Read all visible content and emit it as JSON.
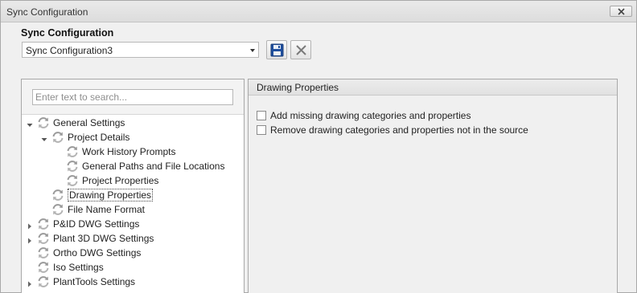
{
  "window": {
    "title": "Sync Configuration"
  },
  "config": {
    "label": "Sync Configuration",
    "selected": "Sync Configuration3"
  },
  "toolbar": {
    "save_icon": "floppy-disk-icon",
    "delete_icon": "x-delete-icon"
  },
  "search": {
    "placeholder": "Enter text to search..."
  },
  "tree": {
    "nodes": [
      {
        "label": "General Settings",
        "expander": "expanded",
        "icon": "sync-icon"
      },
      {
        "label": "Project Details",
        "expander": "expanded",
        "icon": "sync-icon"
      },
      {
        "label": "Work History Prompts",
        "expander": "none",
        "icon": "sync-icon"
      },
      {
        "label": "General Paths and File Locations",
        "expander": "none",
        "icon": "sync-icon"
      },
      {
        "label": "Project Properties",
        "expander": "none",
        "icon": "sync-icon"
      },
      {
        "label": "Drawing Properties",
        "expander": "none",
        "icon": "sync-icon",
        "selected": true
      },
      {
        "label": "File Name Format",
        "expander": "none",
        "icon": "sync-icon"
      },
      {
        "label": "P&ID DWG Settings",
        "expander": "collapsed",
        "icon": "sync-icon"
      },
      {
        "label": "Plant 3D DWG Settings",
        "expander": "collapsed",
        "icon": "sync-icon"
      },
      {
        "label": "Ortho DWG Settings",
        "expander": "none",
        "icon": "sync-icon"
      },
      {
        "label": "Iso Settings",
        "expander": "none",
        "icon": "sync-icon"
      },
      {
        "label": "PlantTools Settings",
        "expander": "collapsed",
        "icon": "sync-icon"
      }
    ]
  },
  "detail": {
    "title": "Drawing Properties",
    "options": [
      {
        "label": "Add missing drawing categories and properties",
        "checked": false
      },
      {
        "label": "Remove drawing categories and properties not in the source",
        "checked": false
      }
    ]
  }
}
